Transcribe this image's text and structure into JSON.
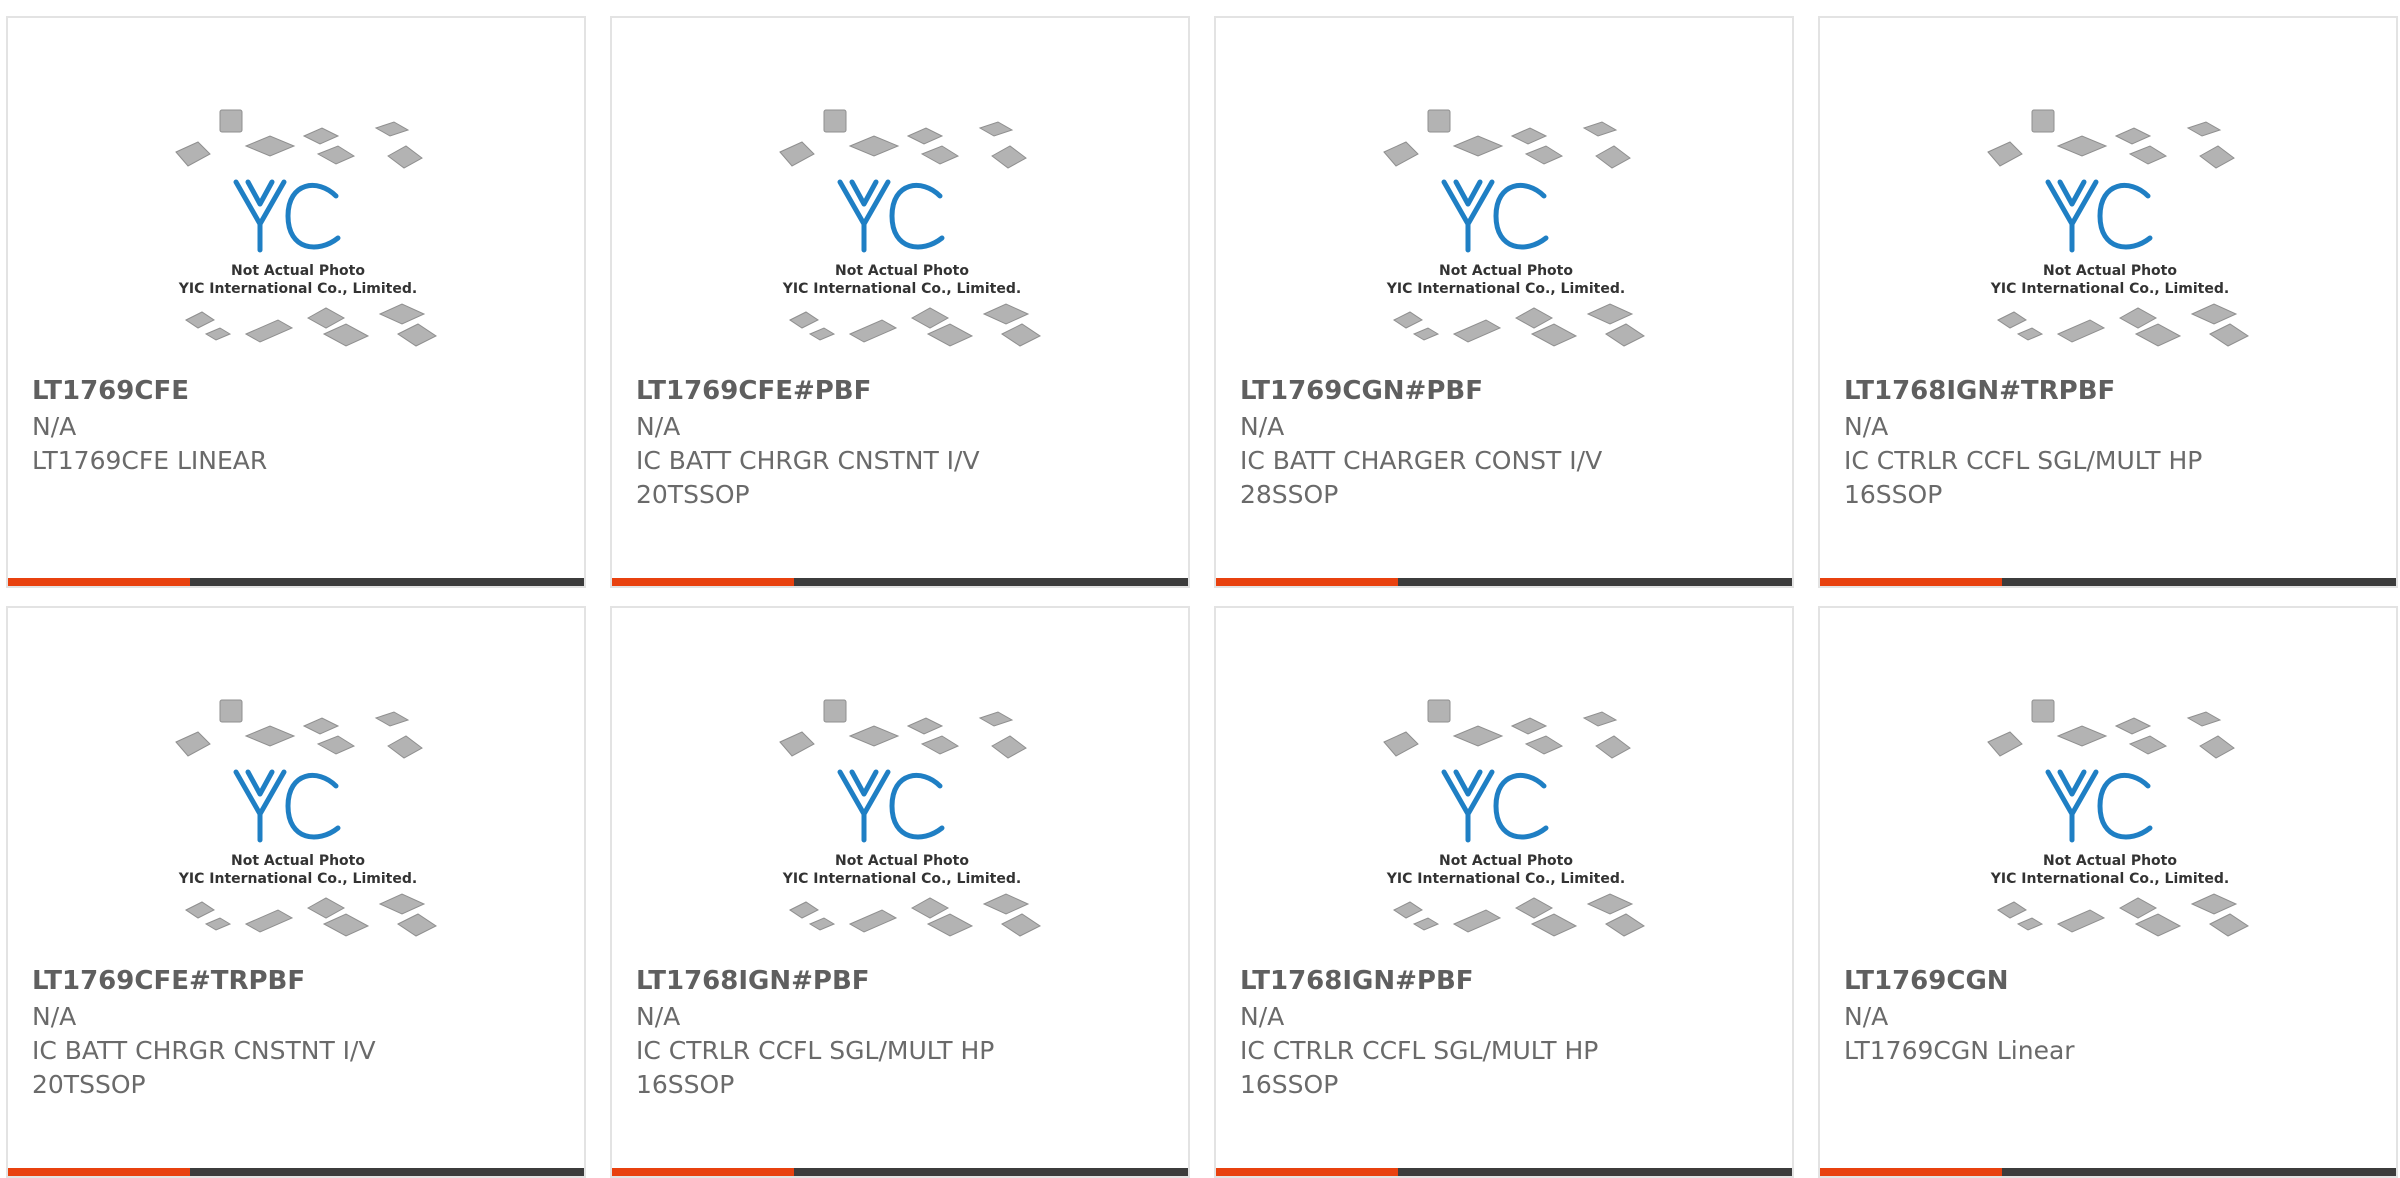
{
  "logo_text": "YIC",
  "photo_note": {
    "line1": "Not Actual Photo",
    "line2": "YIC International Co., Limited."
  },
  "colors": {
    "accent": "#e8410f",
    "bar_dark": "#3c3c3c",
    "logo_blue": "#1f7fc4",
    "chip_gray": "#b3b3b3"
  },
  "products": [
    {
      "part_number": "LT1769CFE",
      "manufacturer": "N/A",
      "desc1": "LT1769CFE LINEAR",
      "desc2": ""
    },
    {
      "part_number": "LT1769CFE#PBF",
      "manufacturer": "N/A",
      "desc1": "IC BATT CHRGR CNSTNT I/V",
      "desc2": "20TSSOP"
    },
    {
      "part_number": "LT1769CGN#PBF",
      "manufacturer": "N/A",
      "desc1": "IC BATT CHARGER CONST I/V",
      "desc2": "28SSOP"
    },
    {
      "part_number": "LT1768IGN#TRPBF",
      "manufacturer": "N/A",
      "desc1": "IC CTRLR CCFL SGL/MULT HP",
      "desc2": "16SSOP"
    },
    {
      "part_number": "LT1769CFE#TRPBF",
      "manufacturer": "N/A",
      "desc1": "IC BATT CHRGR CNSTNT I/V",
      "desc2": "20TSSOP"
    },
    {
      "part_number": "LT1768IGN#PBF",
      "manufacturer": "N/A",
      "desc1": "IC CTRLR CCFL SGL/MULT HP",
      "desc2": "16SSOP"
    },
    {
      "part_number": "LT1768IGN#PBF",
      "manufacturer": "N/A",
      "desc1": "IC CTRLR CCFL SGL/MULT HP",
      "desc2": "16SSOP"
    },
    {
      "part_number": "LT1769CGN",
      "manufacturer": "N/A",
      "desc1": "LT1769CGN Linear",
      "desc2": ""
    }
  ]
}
